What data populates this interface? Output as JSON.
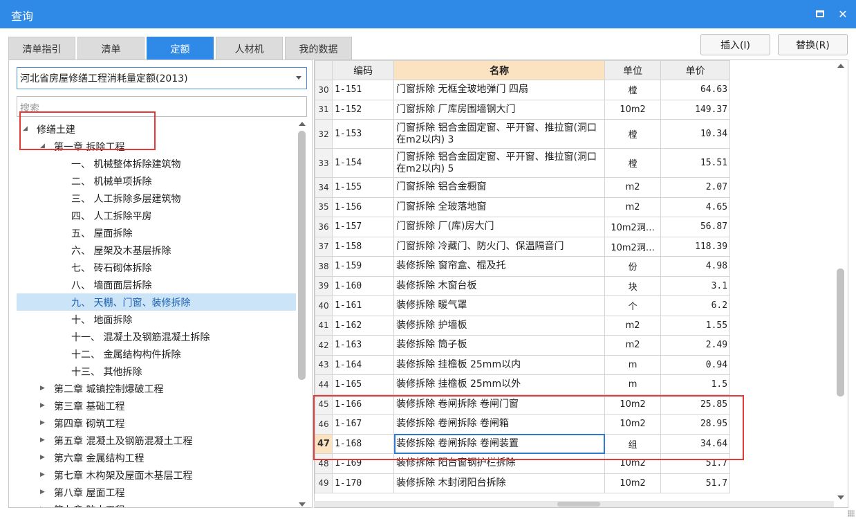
{
  "window": {
    "title": "查询"
  },
  "tabs": [
    {
      "label": "清单指引",
      "active": false
    },
    {
      "label": "清单",
      "active": false
    },
    {
      "label": "定额",
      "active": true
    },
    {
      "label": "人材机",
      "active": false
    },
    {
      "label": "我的数据",
      "active": false
    }
  ],
  "buttons": {
    "insert": "插入(I)",
    "replace": "替换(R)"
  },
  "left": {
    "library": "河北省房屋修缮工程消耗量定额(2013)",
    "search_placeholder": "搜索",
    "tree": [
      {
        "label": "修缮土建",
        "level": 0,
        "expanded": true
      },
      {
        "label": "第一章 拆除工程",
        "level": 1,
        "expanded": true
      },
      {
        "label": "一、 机械整体拆除建筑物",
        "level": 2
      },
      {
        "label": "二、 机械单项拆除",
        "level": 2
      },
      {
        "label": "三、 人工拆除多层建筑物",
        "level": 2
      },
      {
        "label": "四、 人工拆除平房",
        "level": 2
      },
      {
        "label": "五、 屋面拆除",
        "level": 2
      },
      {
        "label": "六、 屋架及木基层拆除",
        "level": 2
      },
      {
        "label": "七、 砖石砌体拆除",
        "level": 2
      },
      {
        "label": "八、 墙面面层拆除",
        "level": 2
      },
      {
        "label": "九、 天棚、门窗、装修拆除",
        "level": 2,
        "selected": true
      },
      {
        "label": "十、 地面拆除",
        "level": 2
      },
      {
        "label": "十一、 混凝土及钢筋混凝土拆除",
        "level": 2
      },
      {
        "label": "十二、 金属结构构件拆除",
        "level": 2
      },
      {
        "label": "十三、 其他拆除",
        "level": 2
      },
      {
        "label": "第二章 城镇控制爆破工程",
        "level": 1,
        "expanded": false
      },
      {
        "label": "第三章 基础工程",
        "level": 1,
        "expanded": false
      },
      {
        "label": "第四章 砌筑工程",
        "level": 1,
        "expanded": false
      },
      {
        "label": "第五章 混凝土及钢筋混凝土工程",
        "level": 1,
        "expanded": false
      },
      {
        "label": "第六章 金属结构工程",
        "level": 1,
        "expanded": false
      },
      {
        "label": "第七章 木构架及屋面木基层工程",
        "level": 1,
        "expanded": false
      },
      {
        "label": "第八章 屋面工程",
        "level": 1,
        "expanded": false
      },
      {
        "label": "第九章 防水工程",
        "level": 1,
        "expanded": false
      }
    ]
  },
  "grid": {
    "headers": {
      "code": "编码",
      "name": "名称",
      "unit": "单位",
      "price": "单价"
    },
    "current_row": 47,
    "rows": [
      {
        "no": "30",
        "code": "1-151",
        "name": "门窗拆除 无框全玻地弹门 四扇",
        "unit": "樘",
        "price": "64.63"
      },
      {
        "no": "31",
        "code": "1-152",
        "name": "门窗拆除 厂库房围墙钢大门",
        "unit": "10m2",
        "price": "149.37"
      },
      {
        "no": "32",
        "code": "1-153",
        "name": "门窗拆除 铝合金固定窗、平开窗、推拉窗(洞口在m2以内) 3",
        "unit": "樘",
        "price": "10.34",
        "tall": true
      },
      {
        "no": "33",
        "code": "1-154",
        "name": "门窗拆除 铝合金固定窗、平开窗、推拉窗(洞口在m2以内) 5",
        "unit": "樘",
        "price": "15.51",
        "tall": true
      },
      {
        "no": "34",
        "code": "1-155",
        "name": "门窗拆除 铝合金橱窗",
        "unit": "m2",
        "price": "2.07"
      },
      {
        "no": "35",
        "code": "1-156",
        "name": "门窗拆除 全玻落地窗",
        "unit": "m2",
        "price": "4.65"
      },
      {
        "no": "36",
        "code": "1-157",
        "name": "门窗拆除 厂(库)房大门",
        "unit": "10m2洞…",
        "price": "56.87"
      },
      {
        "no": "37",
        "code": "1-158",
        "name": "门窗拆除 冷藏门、防火门、保温隔音门",
        "unit": "10m2洞…",
        "price": "118.39"
      },
      {
        "no": "38",
        "code": "1-159",
        "name": "装修拆除 窗帘盒、棍及托",
        "unit": "份",
        "price": "4.98"
      },
      {
        "no": "39",
        "code": "1-160",
        "name": "装修拆除 木窗台板",
        "unit": "块",
        "price": "3.1"
      },
      {
        "no": "40",
        "code": "1-161",
        "name": "装修拆除 暖气罩",
        "unit": "个",
        "price": "6.2"
      },
      {
        "no": "41",
        "code": "1-162",
        "name": "装修拆除 护墙板",
        "unit": "m2",
        "price": "1.55"
      },
      {
        "no": "42",
        "code": "1-163",
        "name": "装修拆除 筒子板",
        "unit": "m2",
        "price": "2.49"
      },
      {
        "no": "43",
        "code": "1-164",
        "name": "装修拆除 挂檐板 25mm以内",
        "unit": "m",
        "price": "0.94"
      },
      {
        "no": "44",
        "code": "1-165",
        "name": "装修拆除 挂檐板 25mm以外",
        "unit": "m",
        "price": "1.5"
      },
      {
        "no": "45",
        "code": "1-166",
        "name": "装修拆除 卷闸拆除 卷闸门窗",
        "unit": "10m2",
        "price": "25.85"
      },
      {
        "no": "46",
        "code": "1-167",
        "name": "装修拆除 卷闸拆除 卷闸箱",
        "unit": "10m2",
        "price": "28.95"
      },
      {
        "no": "47",
        "code": "1-168",
        "name": "装修拆除 卷闸拆除 卷闸装置",
        "unit": "组",
        "price": "34.64"
      },
      {
        "no": "48",
        "code": "1-169",
        "name": "装修拆除 阳台窗钢护栏拆除",
        "unit": "10m2",
        "price": "51.7"
      },
      {
        "no": "49",
        "code": "1-170",
        "name": "装修拆除 木封闭阳台拆除",
        "unit": "10m2",
        "price": "51.7"
      }
    ]
  }
}
